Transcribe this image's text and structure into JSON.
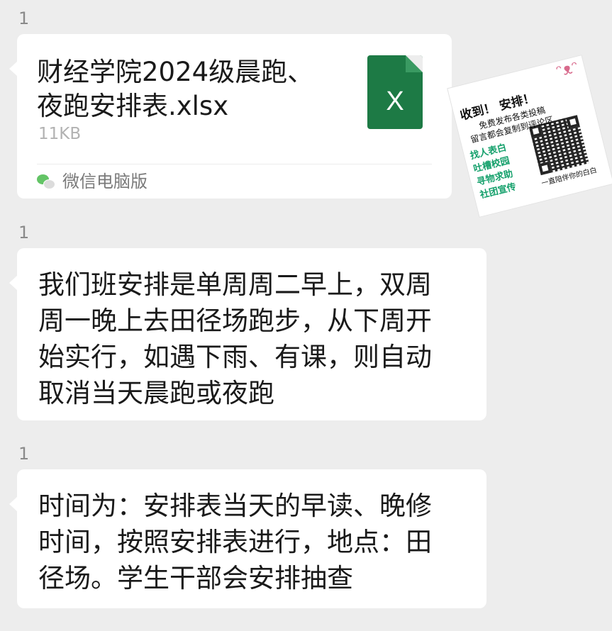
{
  "messages": [
    {
      "sender": "1",
      "type": "file",
      "file_name": "财经学院2024级晨跑、\n夜跑安排表.xlsx",
      "file_size": "11KB",
      "file_icon_letter": "X",
      "source_label": "微信电脑版"
    },
    {
      "sender": "1",
      "type": "text",
      "text": "我们班安排是单周周二早上，双周\n周一晚上去田径场跑步，从下周开\n始实行，如遇下雨、有课，则自动\n取消当天晨跑或夜跑"
    },
    {
      "sender": "1",
      "type": "text",
      "text": "时间为：安排表当天的早读、晚修\n时间，按照安排表进行，地点：田\n径场。学生干部会安排抽查"
    }
  ],
  "sticker": {
    "headline": "收到！ 安排！",
    "line1": "免费发布各类投稿",
    "line2": "留言都会复制到评论区",
    "tags": [
      "找人表白",
      "吐槽校园",
      "寻物求助",
      "社团宣传"
    ],
    "footer": "一直陪伴你的白白"
  },
  "colors": {
    "background": "#ededed",
    "bubble": "#ffffff",
    "excel_green": "#1d7a45",
    "wechat_green": "#63c466"
  },
  "icons": {
    "file": "excel-file-icon",
    "source": "wechat-icon"
  }
}
